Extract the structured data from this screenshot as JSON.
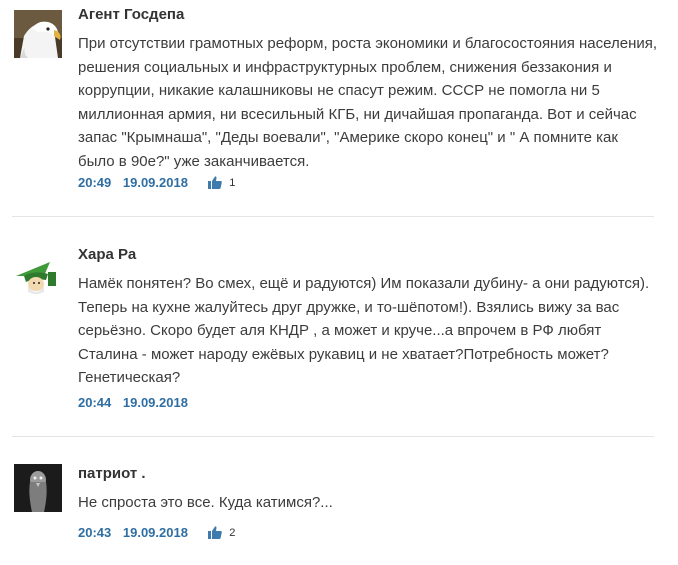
{
  "colors": {
    "link": "#2f6ea2",
    "like_icon": "#3f7cad",
    "divider": "#e4e4e4"
  },
  "comments": [
    {
      "author": "Агент Госдепа",
      "avatar_icon": "eagle-avatar-icon",
      "text": "При отсутствии грамотных реформ, роста экономики и благосостояния населения, решения социальных и инфраструктурных проблем, снижения беззакония и коррупции, никакие калашниковы не спасут режим. СССР не помогла ни 5 миллионная армия, ни всесильный КГБ, ни дичайшая пропаганда. Вот и сейчас запас \"Крымнаша\", \"Деды воевали\", \"Америке скоро конец\" и \" А помните как было в 90е?\" уже заканчивается.",
      "time": "20:49",
      "date": "19.09.2018",
      "likes": "1"
    },
    {
      "author": "Хара Ра",
      "avatar_icon": "gnome-avatar-icon",
      "text": "Намёк понятен? Во смех, ещё и радуются) Им показали дубину- а они радуются). Теперь на кухне жалуйтесь друг дружке, и то-шёпотом!). Взялись вижу за вас серьёзно. Скоро будет аля КНДР , а может и круче...а впрочем в РФ любят Сталина - может народу ежёвых рукавиц и не хватает?Потребность может? Генетическая?",
      "time": "20:44",
      "date": "19.09.2018",
      "likes": ""
    },
    {
      "author": "патриот .",
      "avatar_icon": "bird-avatar-icon",
      "text": "Не спроста это все. Куда катимся?...",
      "time": "20:43",
      "date": "19.09.2018",
      "likes": "2"
    }
  ]
}
